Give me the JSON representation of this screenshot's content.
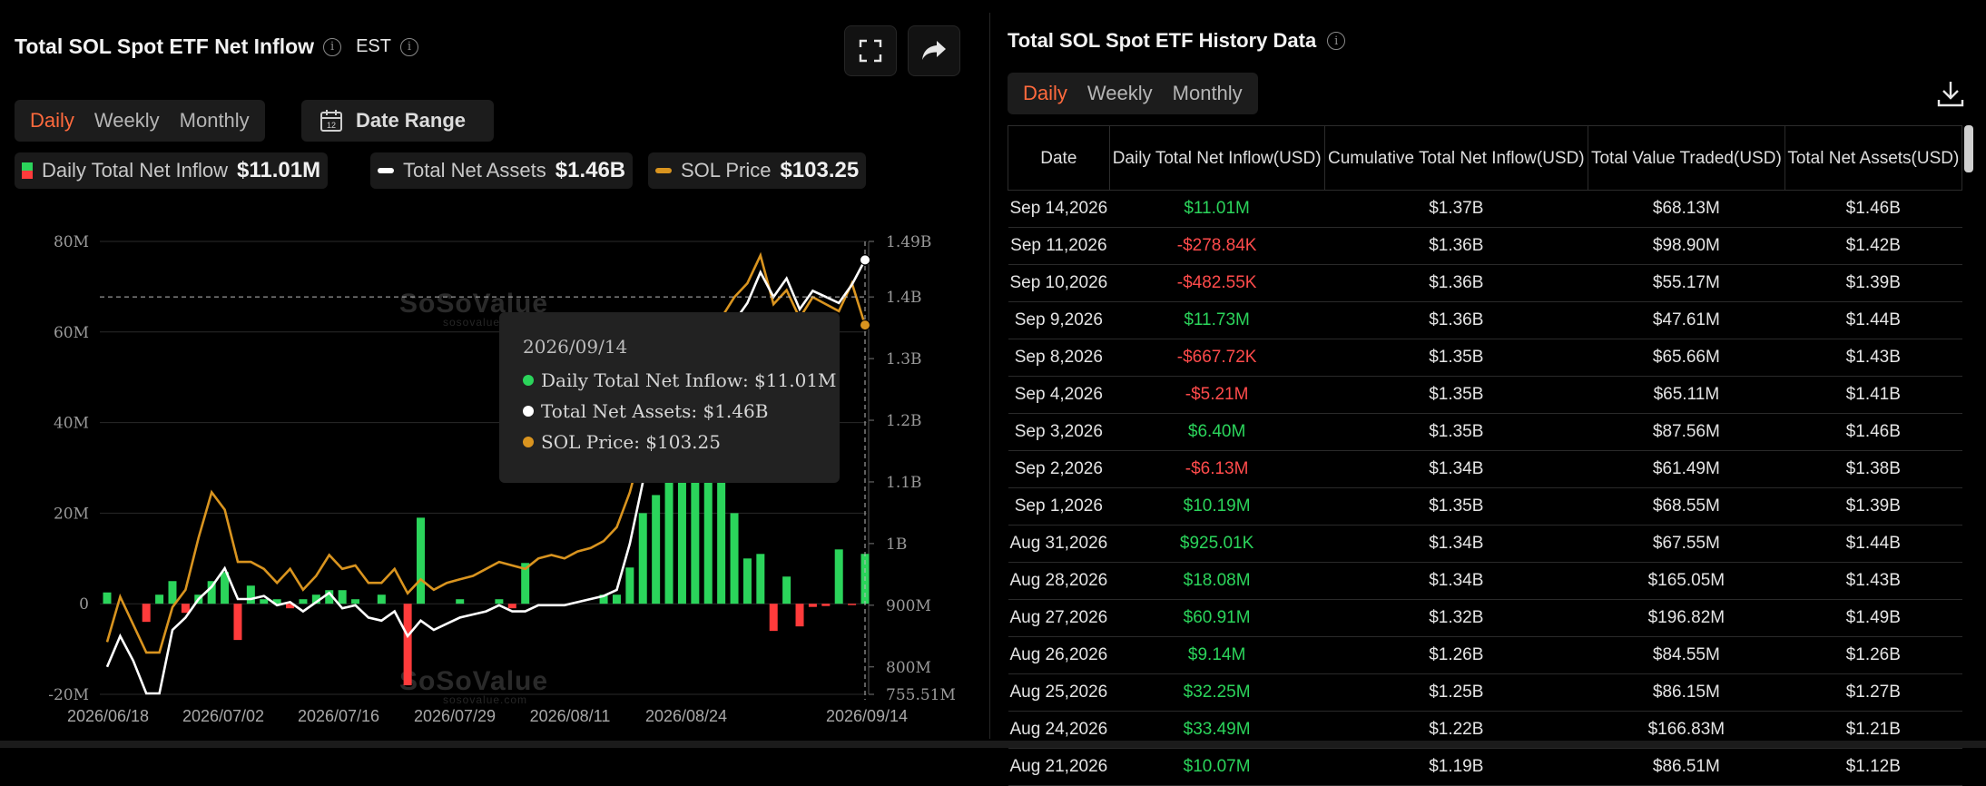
{
  "left": {
    "title": "Total SOL Spot ETF Net Inflow",
    "timezone": "EST",
    "period_tabs": [
      "Daily",
      "Weekly",
      "Monthly"
    ],
    "active_period": "Daily",
    "date_range_label": "Date Range",
    "legend": [
      {
        "name": "Daily Total Net Inflow",
        "value": "$11.01M",
        "color": "#2bd45b"
      },
      {
        "name": "Total Net Assets",
        "value": "$1.46B",
        "color": "#ffffff"
      },
      {
        "name": "SOL Price",
        "value": "$103.25",
        "color": "#d9941f"
      }
    ],
    "tooltip": {
      "date": "2026/09/14",
      "rows": [
        {
          "text": "Daily Total Net Inflow: $11.01M",
          "color": "#2bd45b"
        },
        {
          "text": "Total Net Assets: $1.46B",
          "color": "#ffffff"
        },
        {
          "text": "SOL Price: $103.25",
          "color": "#d9941f"
        }
      ]
    },
    "watermark": "SoSoValue",
    "watermark_sub": "sosovalue.com"
  },
  "chart_data": {
    "type": "bar",
    "title": "Total SOL Spot ETF Net Inflow",
    "x_tick_labels": [
      "2026/06/18",
      "2026/07/02",
      "2026/07/16",
      "2026/07/29",
      "2026/08/11",
      "2026/08/24",
      "2026/09/14"
    ],
    "y_left_ticks": [
      "80M",
      "60M",
      "40M",
      "20M",
      "0",
      "-20M"
    ],
    "y_left_range": [
      -20,
      80
    ],
    "y_right_ticks": [
      "1.49B",
      "1.4B",
      "1.3B",
      "1.2B",
      "1.1B",
      "1B",
      "900M",
      "800M",
      "755.51M"
    ],
    "y_right_range": [
      755.51,
      1490
    ],
    "series": [
      {
        "name": "Daily Total Net Inflow",
        "unit": "M USD",
        "values": [
          2.5,
          0,
          0,
          -4,
          2,
          5,
          -2,
          2,
          5,
          7,
          -8,
          4,
          1,
          1,
          -1,
          1,
          2,
          3,
          3,
          1,
          0,
          2,
          0,
          -18,
          19,
          0,
          0,
          1,
          0,
          0,
          1,
          -1,
          9,
          0,
          0,
          0,
          0,
          0,
          2,
          2,
          8,
          20,
          24,
          45,
          40,
          50,
          30,
          36,
          20,
          10,
          11,
          -6,
          6,
          -5,
          -0.7,
          -0.5,
          12,
          -0.3,
          11.01
        ]
      },
      {
        "name": "Total Net Assets",
        "unit": "M USD",
        "values": [
          800,
          850,
          810,
          757,
          757,
          860,
          880,
          910,
          930,
          960,
          910,
          910,
          915,
          900,
          905,
          890,
          905,
          920,
          895,
          900,
          880,
          875,
          890,
          850,
          875,
          860,
          870,
          880,
          885,
          890,
          900,
          890,
          890,
          900,
          900,
          900,
          905,
          910,
          915,
          925,
          1000,
          1100,
          1180,
          1230,
          1250,
          1280,
          1310,
          1320,
          1360,
          1390,
          1440,
          1400,
          1430,
          1380,
          1410,
          1400,
          1390,
          1420,
          1460
        ]
      },
      {
        "name": "SOL Price",
        "unit": "USD",
        "values": [
          75,
          88,
          80,
          72,
          72,
          85,
          90,
          105,
          118,
          113,
          98,
          98,
          96,
          92,
          96,
          90,
          94,
          100,
          96,
          97,
          92,
          92,
          96,
          89,
          93,
          90,
          92,
          93,
          94,
          96,
          98,
          97,
          96,
          99,
          100,
          99,
          101,
          102,
          104,
          108,
          118,
          132,
          142,
          148,
          152,
          158,
          162,
          168,
          174,
          178,
          186,
          172,
          176,
          168,
          174,
          172,
          170,
          178,
          103.25
        ]
      }
    ]
  },
  "right": {
    "title": "Total SOL Spot ETF History Data",
    "period_tabs": [
      "Daily",
      "Weekly",
      "Monthly"
    ],
    "active_period": "Daily",
    "columns": [
      "Date",
      "Daily Total Net Inflow(USD)",
      "Cumulative Total Net Inflow(USD)",
      "Total Value Traded(USD)",
      "Total Net Assets(USD)"
    ],
    "rows": [
      [
        "Sep 14,2026",
        "$11.01M",
        "$1.37B",
        "$68.13M",
        "$1.46B"
      ],
      [
        "Sep 11,2026",
        "-$278.84K",
        "$1.36B",
        "$98.90M",
        "$1.42B"
      ],
      [
        "Sep 10,2026",
        "-$482.55K",
        "$1.36B",
        "$55.17M",
        "$1.39B"
      ],
      [
        "Sep 9,2026",
        "$11.73M",
        "$1.36B",
        "$47.61M",
        "$1.44B"
      ],
      [
        "Sep 8,2026",
        "-$667.72K",
        "$1.35B",
        "$65.66M",
        "$1.43B"
      ],
      [
        "Sep 4,2026",
        "-$5.21M",
        "$1.35B",
        "$65.11M",
        "$1.41B"
      ],
      [
        "Sep 3,2026",
        "$6.40M",
        "$1.35B",
        "$87.56M",
        "$1.46B"
      ],
      [
        "Sep 2,2026",
        "-$6.13M",
        "$1.34B",
        "$61.49M",
        "$1.38B"
      ],
      [
        "Sep 1,2026",
        "$10.19M",
        "$1.35B",
        "$68.55M",
        "$1.39B"
      ],
      [
        "Aug 31,2026",
        "$925.01K",
        "$1.34B",
        "$67.55M",
        "$1.44B"
      ],
      [
        "Aug 28,2026",
        "$18.08M",
        "$1.34B",
        "$165.05M",
        "$1.43B"
      ],
      [
        "Aug 27,2026",
        "$60.91M",
        "$1.32B",
        "$196.82M",
        "$1.49B"
      ],
      [
        "Aug 26,2026",
        "$9.14M",
        "$1.26B",
        "$84.55M",
        "$1.26B"
      ],
      [
        "Aug 25,2026",
        "$32.25M",
        "$1.25B",
        "$86.15M",
        "$1.27B"
      ],
      [
        "Aug 24,2026",
        "$33.49M",
        "$1.22B",
        "$166.83M",
        "$1.21B"
      ],
      [
        "Aug 21,2026",
        "$10.07M",
        "$1.19B",
        "$86.51M",
        "$1.12B"
      ]
    ]
  }
}
